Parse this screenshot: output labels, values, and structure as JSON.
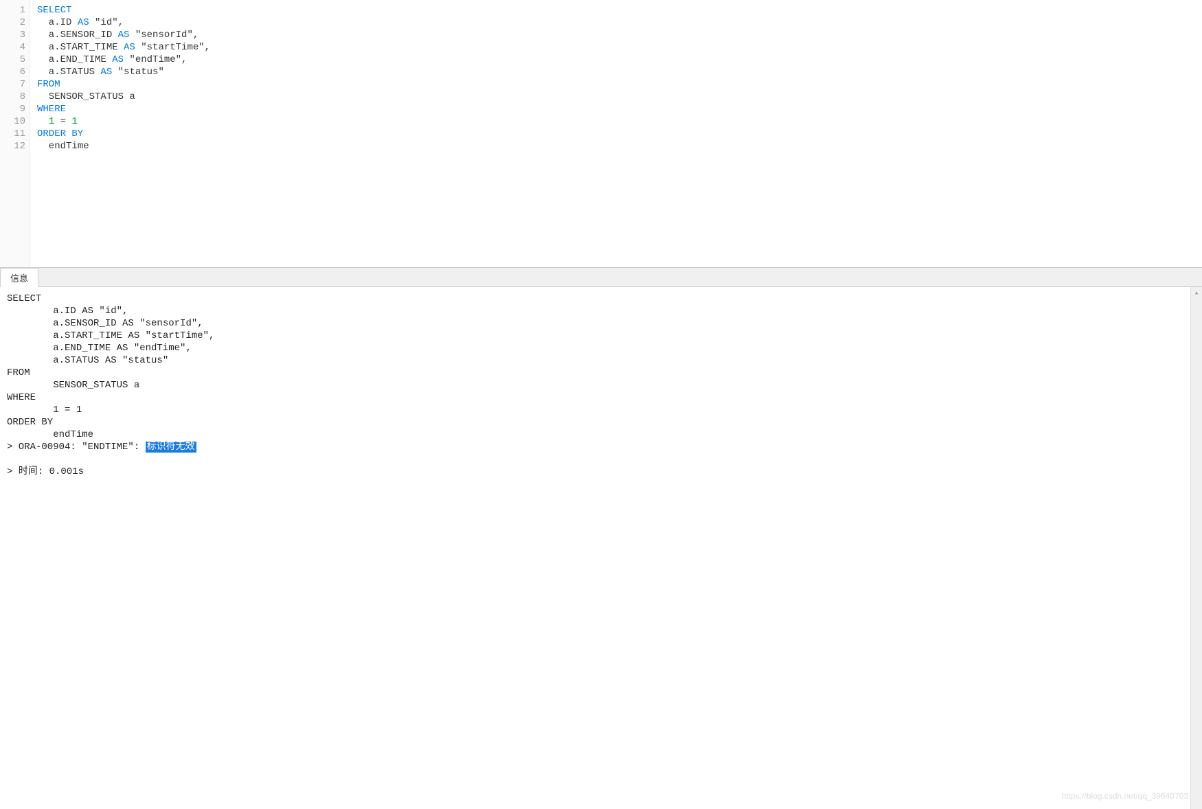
{
  "editor": {
    "lines": [
      {
        "n": "1",
        "segments": [
          {
            "cls": "kw",
            "t": "SELECT"
          }
        ]
      },
      {
        "n": "2",
        "segments": [
          {
            "cls": "txt",
            "t": "  a.ID "
          },
          {
            "cls": "kw",
            "t": "AS"
          },
          {
            "cls": "txt",
            "t": " \"id\","
          }
        ]
      },
      {
        "n": "3",
        "segments": [
          {
            "cls": "txt",
            "t": "  a.SENSOR_ID "
          },
          {
            "cls": "kw",
            "t": "AS"
          },
          {
            "cls": "txt",
            "t": " \"sensorId\","
          }
        ]
      },
      {
        "n": "4",
        "segments": [
          {
            "cls": "txt",
            "t": "  a.START_TIME "
          },
          {
            "cls": "kw",
            "t": "AS"
          },
          {
            "cls": "txt",
            "t": " \"startTime\","
          }
        ]
      },
      {
        "n": "5",
        "segments": [
          {
            "cls": "txt",
            "t": "  a.END_TIME "
          },
          {
            "cls": "kw",
            "t": "AS"
          },
          {
            "cls": "txt",
            "t": " \"endTime\","
          }
        ]
      },
      {
        "n": "6",
        "segments": [
          {
            "cls": "txt",
            "t": "  a.STATUS "
          },
          {
            "cls": "kw",
            "t": "AS"
          },
          {
            "cls": "txt",
            "t": " \"status\""
          }
        ]
      },
      {
        "n": "7",
        "segments": [
          {
            "cls": "kw",
            "t": "FROM"
          }
        ]
      },
      {
        "n": "8",
        "segments": [
          {
            "cls": "txt",
            "t": "  SENSOR_STATUS a"
          }
        ]
      },
      {
        "n": "9",
        "segments": [
          {
            "cls": "kw",
            "t": "WHERE"
          }
        ]
      },
      {
        "n": "10",
        "segments": [
          {
            "cls": "txt",
            "t": "  "
          },
          {
            "cls": "num",
            "t": "1"
          },
          {
            "cls": "txt",
            "t": " = "
          },
          {
            "cls": "num",
            "t": "1"
          }
        ]
      },
      {
        "n": "11",
        "segments": [
          {
            "cls": "kw",
            "t": "ORDER BY"
          }
        ]
      },
      {
        "n": "12",
        "segments": [
          {
            "cls": "txt",
            "t": "  endTime"
          }
        ]
      }
    ]
  },
  "tab": {
    "label": "信息"
  },
  "output": {
    "rows": [
      {
        "t": "SELECT"
      },
      {
        "t": "        a.ID AS \"id\","
      },
      {
        "t": "        a.SENSOR_ID AS \"sensorId\","
      },
      {
        "t": "        a.START_TIME AS \"startTime\","
      },
      {
        "t": "        a.END_TIME AS \"endTime\","
      },
      {
        "t": "        a.STATUS AS \"status\""
      },
      {
        "t": "FROM"
      },
      {
        "t": "        SENSOR_STATUS a"
      },
      {
        "t": "WHERE"
      },
      {
        "t": "        1 = 1"
      },
      {
        "t": "ORDER BY"
      },
      {
        "t": "        endTime"
      }
    ],
    "error_prefix": "> ORA-00904: \"ENDTIME\": ",
    "error_highlight": "标识符无效",
    "time_line": "> 时间: 0.001s"
  },
  "watermark": "https://blog.csdn.net/qq_39640703"
}
